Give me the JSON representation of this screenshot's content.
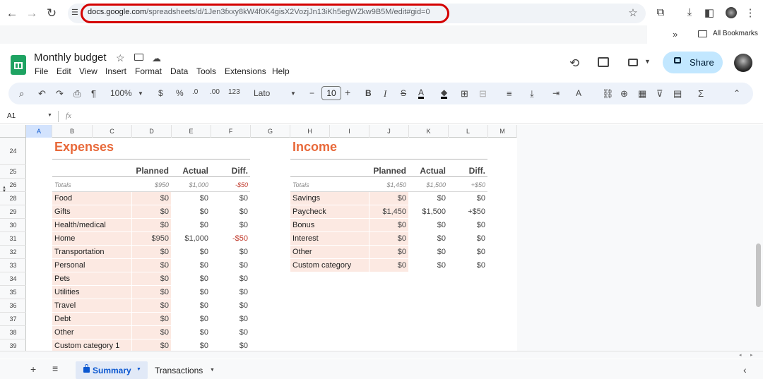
{
  "browser": {
    "url_host": "docs.google.com",
    "url_path": "/spreadsheets/d/1Jen3fxxy8kW4f0K4gisX2VozjJn13iKh5egWZkw9B5M/edit#gid=0",
    "bookmarks_label": "All Bookmarks",
    "overflow": "»"
  },
  "doc": {
    "title": "Monthly budget"
  },
  "menu": [
    "File",
    "Edit",
    "View",
    "Insert",
    "Format",
    "Data",
    "Tools",
    "Extensions",
    "Help"
  ],
  "share_label": "Share",
  "toolbar": {
    "zoom": "100%",
    "currency": "$",
    "percent": "%",
    "dec_less": ".0",
    "dec_more": ".00",
    "format_num": "123",
    "font": "Lato",
    "font_size": "10",
    "minus": "−",
    "plus": "+",
    "bold": "B",
    "italic": "I"
  },
  "namebox": "A1",
  "fx": "fx",
  "columns": [
    "A",
    "B",
    "C",
    "D",
    "E",
    "F",
    "G",
    "H",
    "I",
    "J",
    "K",
    "L",
    "M"
  ],
  "rows": [
    "24",
    "25",
    "26",
    "28",
    "29",
    "30",
    "31",
    "32",
    "33",
    "34",
    "35",
    "36",
    "37",
    "38",
    "39",
    ""
  ],
  "expenses": {
    "title": "Expenses",
    "headers": [
      "Planned",
      "Actual",
      "Diff."
    ],
    "totals": {
      "label": "Totals",
      "planned": "$950",
      "actual": "$1,000",
      "diff": "-$50"
    },
    "items": [
      {
        "name": "Food",
        "planned": "$0",
        "actual": "$0",
        "diff": "$0"
      },
      {
        "name": "Gifts",
        "planned": "$0",
        "actual": "$0",
        "diff": "$0"
      },
      {
        "name": "Health/medical",
        "planned": "$0",
        "actual": "$0",
        "diff": "$0"
      },
      {
        "name": "Home",
        "planned": "$950",
        "actual": "$1,000",
        "diff": "-$50"
      },
      {
        "name": "Transportation",
        "planned": "$0",
        "actual": "$0",
        "diff": "$0"
      },
      {
        "name": "Personal",
        "planned": "$0",
        "actual": "$0",
        "diff": "$0"
      },
      {
        "name": "Pets",
        "planned": "$0",
        "actual": "$0",
        "diff": "$0"
      },
      {
        "name": "Utilities",
        "planned": "$0",
        "actual": "$0",
        "diff": "$0"
      },
      {
        "name": "Travel",
        "planned": "$0",
        "actual": "$0",
        "diff": "$0"
      },
      {
        "name": "Debt",
        "planned": "$0",
        "actual": "$0",
        "diff": "$0"
      },
      {
        "name": "Other",
        "planned": "$0",
        "actual": "$0",
        "diff": "$0"
      },
      {
        "name": "Custom category 1",
        "planned": "$0",
        "actual": "$0",
        "diff": "$0"
      }
    ]
  },
  "income": {
    "title": "Income",
    "headers": [
      "Planned",
      "Actual",
      "Diff."
    ],
    "totals": {
      "label": "Totals",
      "planned": "$1,450",
      "actual": "$1,500",
      "diff": "+$50"
    },
    "items": [
      {
        "name": "Savings",
        "planned": "$0",
        "actual": "$0",
        "diff": "$0"
      },
      {
        "name": "Paycheck",
        "planned": "$1,450",
        "actual": "$1,500",
        "diff": "+$50"
      },
      {
        "name": "Bonus",
        "planned": "$0",
        "actual": "$0",
        "diff": "$0"
      },
      {
        "name": "Interest",
        "planned": "$0",
        "actual": "$0",
        "diff": "$0"
      },
      {
        "name": "Other",
        "planned": "$0",
        "actual": "$0",
        "diff": "$0"
      },
      {
        "name": "Custom category",
        "planned": "$0",
        "actual": "$0",
        "diff": "$0"
      }
    ]
  },
  "sheets": {
    "active": "Summary",
    "other": "Transactions"
  },
  "colors": {
    "accent": "#e8693a",
    "highlight": "#d40000",
    "share_bg": "#c2e7ff",
    "cell_tint": "#fce9e2"
  }
}
